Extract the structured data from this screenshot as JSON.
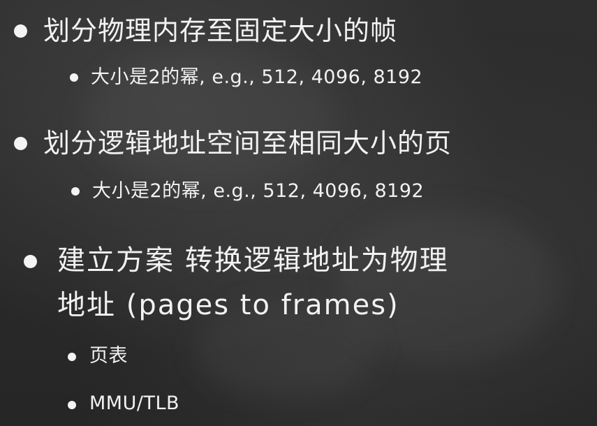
{
  "slide": {
    "items": [
      {
        "text": "划分物理内存至固定大小的帧",
        "sub": "大小是2的幂, e.g., 512, 4096, 8192"
      },
      {
        "text": "划分逻辑地址空间至相同大小的页",
        "sub": "大小是2的幂, e.g., 512, 4096, 8192"
      },
      {
        "text_line1": "建立方案 转换逻辑地址为物理",
        "text_line2": "地址 (pages to frames)",
        "subs": [
          "页表",
          "MMU/TLB"
        ]
      }
    ]
  }
}
